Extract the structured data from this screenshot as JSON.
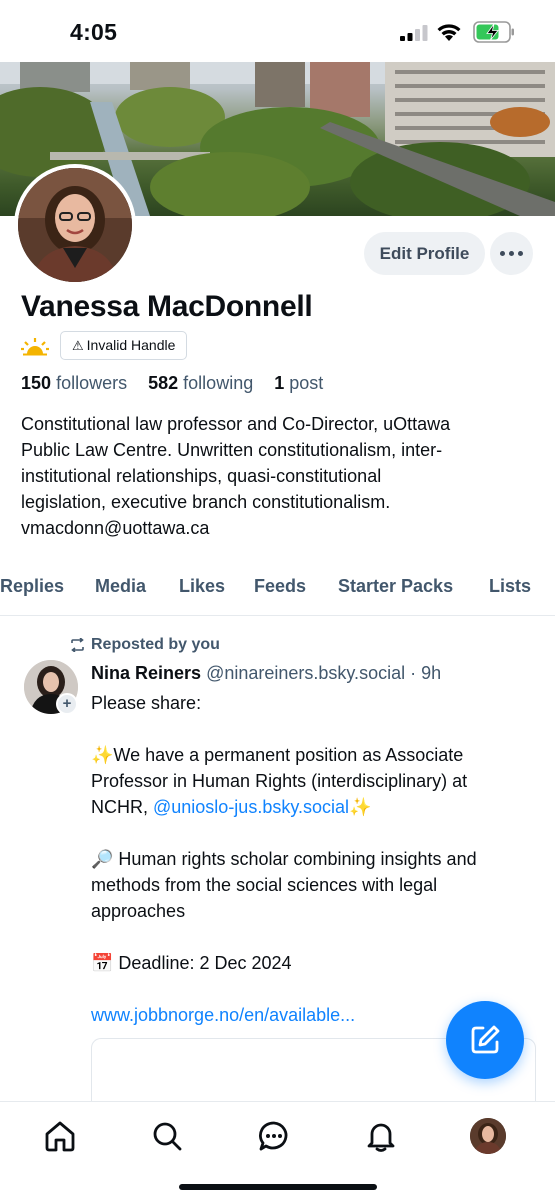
{
  "status_bar": {
    "time": "4:05",
    "battery_level": 0.7
  },
  "profile": {
    "display_name": "Vanessa MacDonnell",
    "handle_badge": "Invalid Handle",
    "edit_button": "Edit Profile",
    "stats": {
      "followers_count": "150",
      "followers_label": "followers",
      "following_count": "582",
      "following_label": "following",
      "posts_count": "1",
      "posts_label": "post"
    },
    "bio_lines": [
      "Constitutional law professor and Co-Director, uOttawa",
      "Public Law Centre. Unwritten constitutionalism, inter-",
      "institutional relationships, quasi-constitutional",
      "legislation, executive branch constitutionalism.",
      "vmacdonn@uottawa.ca"
    ]
  },
  "tabs": [
    "Replies",
    "Media",
    "Likes",
    "Feeds",
    "Starter Packs",
    "Lists"
  ],
  "post": {
    "repost_label": "Reposted by you",
    "author": "Nina Reiners",
    "handle": "@ninareiners.bsky.social",
    "time": "· 9h",
    "line1": "Please share:",
    "line2a": "✨We have a permanent position as Associate",
    "line2b": "Professor in Human Rights (interdisciplinary) at",
    "line2c_text": "NCHR, ",
    "line2c_link": "@unioslo-jus.bsky.social",
    "line2c_end": "✨",
    "line3a": "🔎 Human rights scholar combining insights and",
    "line3b": "methods from the social sciences with legal",
    "line3c": "approaches",
    "line4": "📅 Deadline: 2 Dec 2024",
    "link": "www.jobbnorge.no/en/available..."
  },
  "colors": {
    "accent": "#1083fe",
    "muted": "#42576c",
    "button_bg": "#eef1f4"
  }
}
